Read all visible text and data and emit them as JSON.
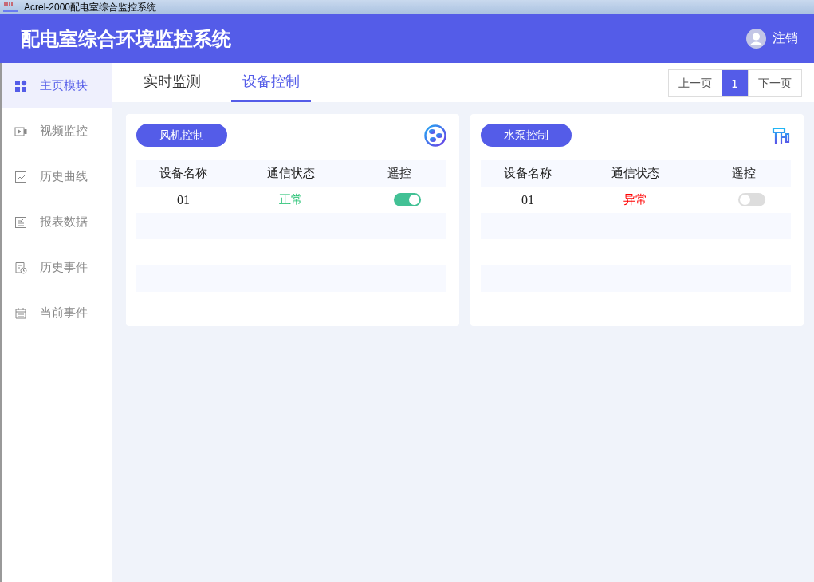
{
  "window": {
    "title": "Acrel-2000配电室综合监控系统"
  },
  "header": {
    "title": "配电室综合环境监控系统",
    "logout": "注销"
  },
  "sidebar": {
    "items": [
      {
        "label": "主页模块",
        "kind": "grid",
        "selected": true
      },
      {
        "label": "视频监控",
        "kind": "video",
        "selected": false
      },
      {
        "label": "历史曲线",
        "kind": "chart",
        "selected": false
      },
      {
        "label": "报表数据",
        "kind": "report",
        "selected": false
      },
      {
        "label": "历史事件",
        "kind": "history",
        "selected": false
      },
      {
        "label": "当前事件",
        "kind": "list",
        "selected": false
      }
    ]
  },
  "tabs": [
    {
      "label": "实时监测",
      "selected": false
    },
    {
      "label": "设备控制",
      "selected": true
    }
  ],
  "pager": {
    "prev": "上一页",
    "pages": [
      {
        "label": "1",
        "selected": true
      }
    ],
    "next": "下一页"
  },
  "panels": [
    {
      "title": "风机控制",
      "kind": "fan",
      "columns": [
        "设备名称",
        "通信状态",
        "遥控"
      ],
      "rows": [
        {
          "name": "01",
          "status": "正常",
          "ok": true,
          "on": true
        }
      ]
    },
    {
      "title": "水泵控制",
      "kind": "pump",
      "columns": [
        "设备名称",
        "通信状态",
        "遥控"
      ],
      "rows": [
        {
          "name": "01",
          "status": "异常",
          "ok": false,
          "on": false
        }
      ]
    }
  ]
}
